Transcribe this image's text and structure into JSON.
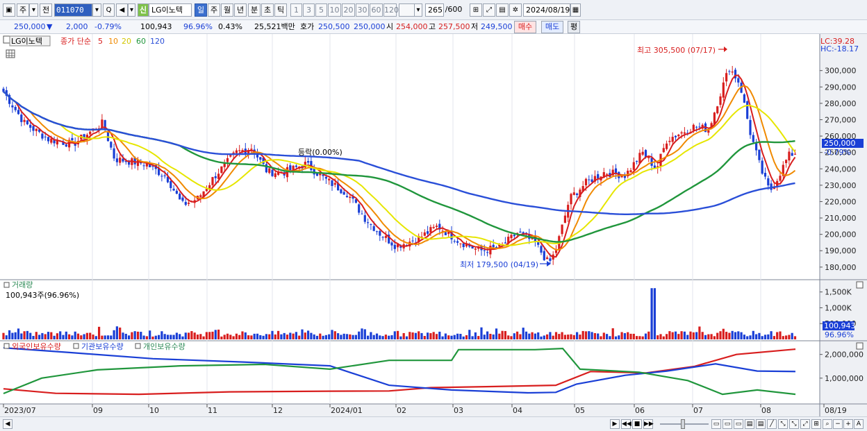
{
  "toolbar": {
    "period_buttons": [
      "주",
      "전"
    ],
    "stock_code": "011070",
    "search_icon_label": "Q",
    "credit_badge": "신",
    "stock_name": "LG이노텍",
    "timeframes": [
      "일",
      "주",
      "월",
      "년",
      "분",
      "초",
      "틱"
    ],
    "minute_options": [
      "1",
      "3",
      "5",
      "10",
      "20",
      "30",
      "60",
      "120"
    ],
    "count_display": "265",
    "count_total": "/600",
    "date": "2024/08/19"
  },
  "quote": {
    "price": "250,000",
    "change": "2,000",
    "change_pct": "-0.79%",
    "volume": "100,943",
    "volume_ratio": "96.96%",
    "turnover_pct": "0.43%",
    "trade_value": "25,521백만",
    "bid_label": "호가",
    "bid1": "250,500",
    "bid2": "250,000",
    "open_label": "시",
    "open": "254,000",
    "high_label": "고",
    "high": "257,500",
    "low_label": "저",
    "low": "249,500",
    "buy_button": "매수",
    "sell_button": "매도",
    "eval_button": "평"
  },
  "price_pane": {
    "legend_stock": "LG이노텍",
    "legend_ma_prefix": "종가 단순",
    "ma_periods": [
      "5",
      "10",
      "20",
      "60",
      "120"
    ],
    "ma_colors": [
      "#d81e1e",
      "#f08a00",
      "#e6e600",
      "#20963c",
      "#2a4fd8"
    ],
    "lc_label": "LC:39.28",
    "hc_label": "HC:-18.17",
    "current_price_tag": "250,000",
    "current_change_tag": "-0.79%",
    "high_annotation": "최고 305,500 (07/17)",
    "low_annotation": "최저 179,500 (04/19)",
    "mid_annotation": "등락(0.00%)"
  },
  "volume_pane": {
    "title": "거래량",
    "value": "100,943주(96.96%)",
    "value_tag": "100,943",
    "ratio_tag": "96.96%",
    "axis_labels": [
      "1,500K",
      "1,000K",
      "500,000"
    ]
  },
  "holdings_pane": {
    "series_labels": [
      "외국인보유수량",
      "기관보유수량",
      "개인보유수량"
    ],
    "axis_labels": [
      "2,000,000",
      "1,000,000"
    ]
  },
  "x_axis_labels": [
    "2023/07",
    "09",
    "10",
    "11",
    "12",
    "2024/01",
    "02",
    "03",
    "04",
    "05",
    "06",
    "07",
    "08",
    "08/19"
  ],
  "chart_data": [
    {
      "type": "line",
      "name": "LG이노텍 일봉 (candlestick)",
      "x": [
        "2023/07",
        "2023/08",
        "2023/09",
        "2023/10",
        "2023/11",
        "2023/12",
        "2024/01",
        "2024/02",
        "2024/03",
        "2024/04",
        "2024/05",
        "2024/06",
        "2024/07",
        "2024/08",
        "08/19"
      ],
      "series": [
        {
          "name": "close",
          "values": [
            287000,
            255000,
            266000,
            232000,
            228000,
            242000,
            240000,
            200000,
            200000,
            193000,
            233000,
            250000,
            300000,
            232000,
            250000
          ]
        }
      ],
      "y_ticks": [
        300000,
        290000,
        280000,
        270000,
        260000,
        250000,
        240000,
        230000,
        220000,
        210000,
        200000,
        190000,
        180000
      ],
      "ylim": [
        174000,
        313000
      ],
      "high": 305500,
      "low": 179500
    },
    {
      "type": "bar",
      "name": "거래량",
      "last_value": 100943,
      "ylim": [
        0,
        1800000
      ]
    },
    {
      "type": "line",
      "name": "보유수량",
      "series": [
        {
          "name": "외국인보유수량",
          "color": "#d81e1e"
        },
        {
          "name": "기관보유수량",
          "color": "#2a4fd8"
        },
        {
          "name": "개인보유수량",
          "color": "#20963c"
        }
      ],
      "y_ticks": [
        2000000,
        1000000
      ]
    }
  ]
}
